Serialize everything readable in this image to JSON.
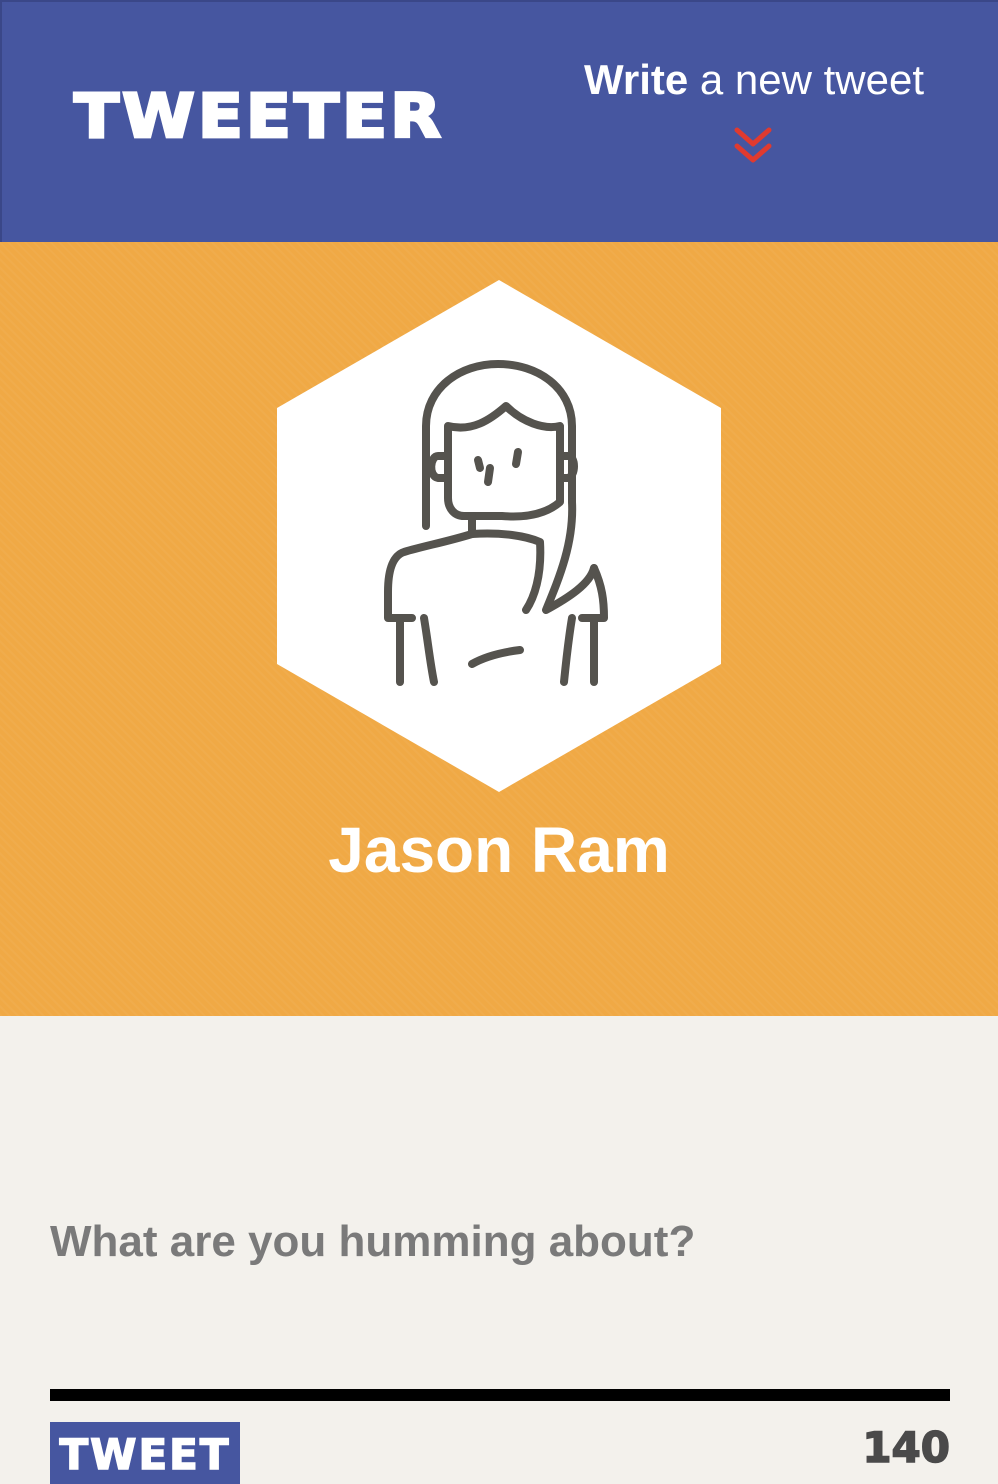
{
  "header": {
    "logo_text": "TWEETER",
    "compose_toggle": {
      "strong": "Write",
      "rest": " a new tweet",
      "icon": "double-chevron-down-icon"
    }
  },
  "profile": {
    "name": "Jason Ram",
    "avatar_icon": "user-avatar-icon"
  },
  "composer": {
    "placeholder": "What are you humming about?",
    "value": "",
    "submit_label": "TWEET",
    "char_count": "140"
  },
  "colors": {
    "header_bg": "#4656a0",
    "profile_bg": "#f0a945",
    "compose_bg": "#f3f1ec",
    "chevron": "#e03a2f",
    "avatar_line": "#55534e",
    "counter": "#4a4a4a"
  }
}
